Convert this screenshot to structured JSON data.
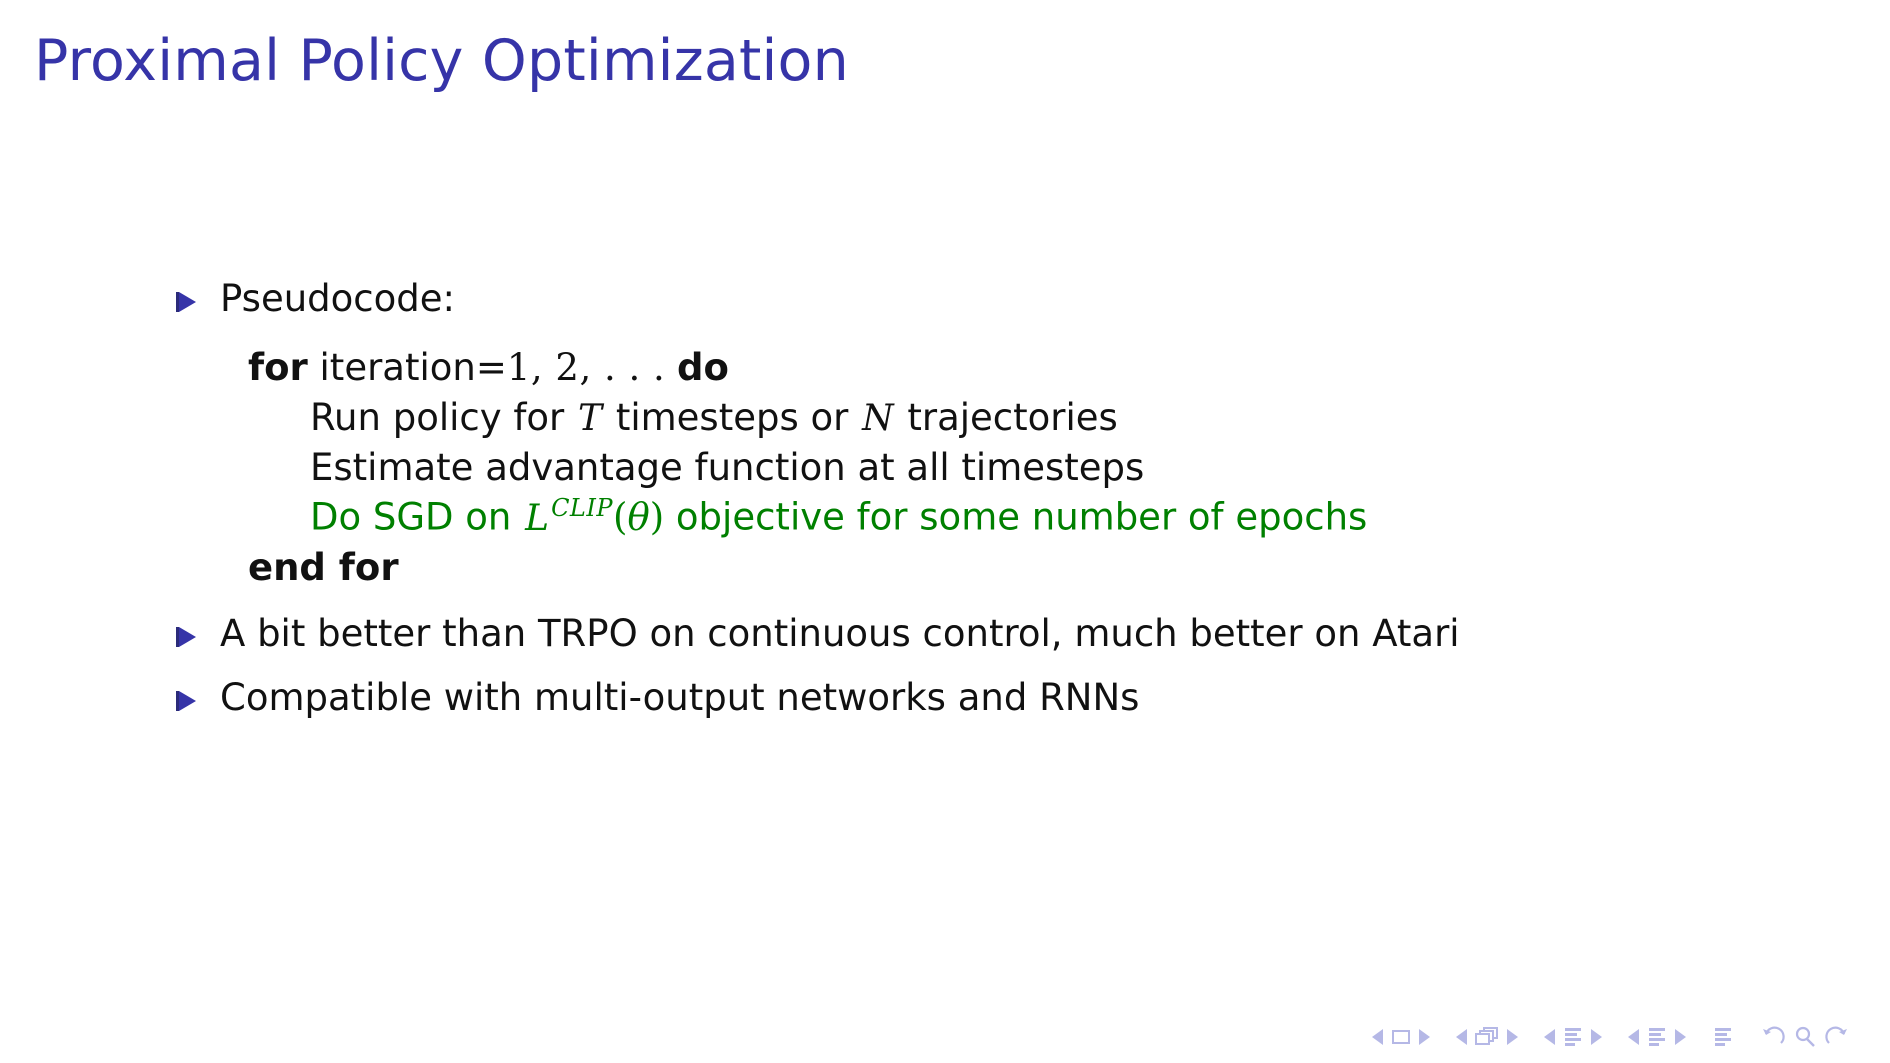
{
  "slide": {
    "title": "Proximal Policy Optimization",
    "title_color": "#3634a8",
    "text_color": "#111111",
    "highlight_color": "#008000",
    "bullet_color": "#3634a8",
    "background_color": "#ffffff"
  },
  "items": [
    {
      "label": "Pseudocode:"
    },
    {
      "label": "A bit better than TRPO on continuous control, much better on Atari"
    },
    {
      "label": "Compatible with multi-output networks and RNNs"
    }
  ],
  "algorithm": {
    "for_keyword": "for",
    "for_condition_prefix": "iteration=",
    "for_condition_math": "1, 2, . . .",
    "do_keyword": "do",
    "line_run_prefix": "Run policy for",
    "line_run_var1": "T",
    "line_run_middle": "timesteps or",
    "line_run_var2": "N",
    "line_run_suffix": "trajectories",
    "line_estimate": "Estimate advantage function at all timesteps",
    "line_sgd_prefix": "Do SGD on",
    "line_sgd_loss_base": "L",
    "line_sgd_loss_sup": "CLIP",
    "line_sgd_open_paren": "(",
    "line_sgd_theta": "θ",
    "line_sgd_close_paren": ")",
    "line_sgd_suffix": "objective for some number of epochs",
    "end_for_keyword": "end for"
  },
  "navigation": {
    "slide_prev": "◀",
    "slide_icon": "slide-icon",
    "slide_next": "▶",
    "frame_prev": "◀",
    "frame_icon": "frames-icon",
    "frame_next": "▶",
    "subsection_prev": "◀",
    "subsection_icon": "subsection-icon",
    "subsection_next": "▶",
    "section_prev": "◀",
    "section_icon": "section-icon",
    "section_next": "▶",
    "doc_icon": "document-icon",
    "back_icon": "back-icon",
    "search_icon": "search-icon",
    "forward_icon": "forward-icon",
    "color": "#b5b8e6"
  }
}
